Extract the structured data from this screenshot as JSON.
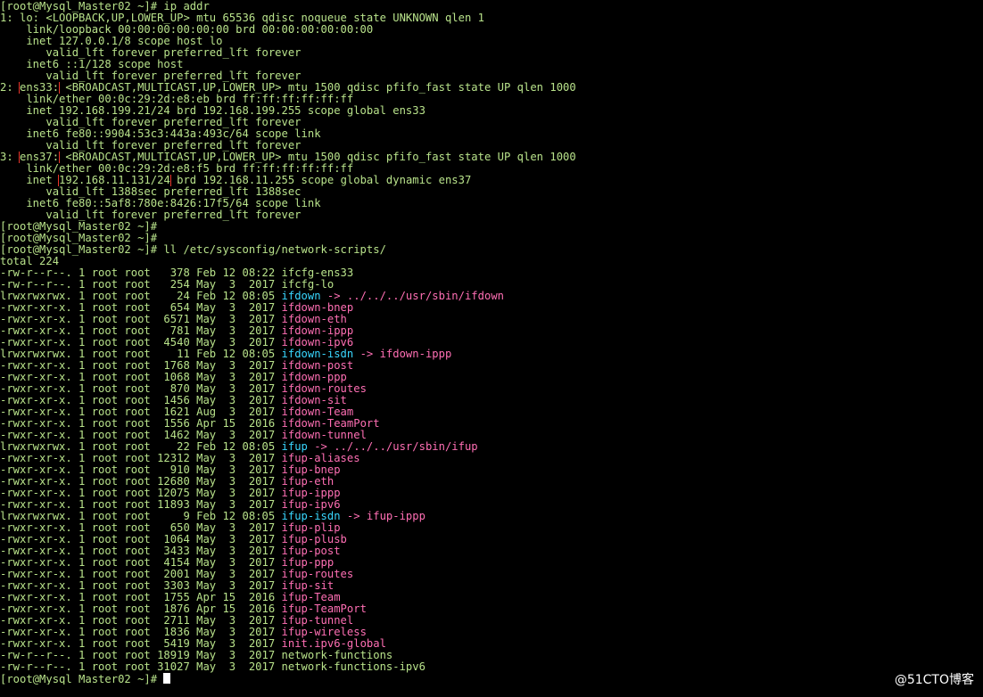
{
  "terminal": {
    "colors": {
      "background": "#000000",
      "text": "#b8e28a",
      "file": "#ff6fb4",
      "symlink": "#39d7ff",
      "highlight_box": "#e8352b",
      "cursor": "#ffffff"
    },
    "lines": [
      [
        {
          "t": "[root@Mysql_Master02 ~]# ip addr",
          "c": "text"
        }
      ],
      [
        {
          "t": "1: lo: <LOOPBACK,UP,LOWER_UP> mtu 65536 qdisc noqueue state UNKNOWN qlen 1",
          "c": "text"
        }
      ],
      [
        {
          "t": "    link/loopback 00:00:00:00:00:00 brd 00:00:00:00:00:00",
          "c": "text"
        }
      ],
      [
        {
          "t": "    inet 127.0.0.1/8 scope host lo",
          "c": "text"
        }
      ],
      [
        {
          "t": "       valid_lft forever preferred_lft forever",
          "c": "text"
        }
      ],
      [
        {
          "t": "    inet6 ::1/128 scope host",
          "c": "text"
        }
      ],
      [
        {
          "t": "       valid_lft forever preferred_lft forever",
          "c": "text"
        }
      ],
      [
        {
          "t": "2: ",
          "c": "text"
        },
        {
          "t": "ens33:",
          "c": "hl"
        },
        {
          "t": " <BROADCAST,MULTICAST,UP,LOWER_UP> mtu 1500 qdisc pfifo_fast state UP qlen 1000",
          "c": "text"
        }
      ],
      [
        {
          "t": "    link/ether 00:0c:29:2d:e8:eb brd ff:ff:ff:ff:ff:ff",
          "c": "text"
        }
      ],
      [
        {
          "t": "    inet 192.168.199.21/24 brd 192.168.199.255 scope global ens33",
          "c": "text"
        }
      ],
      [
        {
          "t": "       valid_lft forever preferred_lft forever",
          "c": "text"
        }
      ],
      [
        {
          "t": "    inet6 fe80::9904:53c3:443a:493c/64 scope link",
          "c": "text"
        }
      ],
      [
        {
          "t": "       valid_lft forever preferred_lft forever",
          "c": "text"
        }
      ],
      [
        {
          "t": "3: ",
          "c": "text"
        },
        {
          "t": "ens37:",
          "c": "hl"
        },
        {
          "t": " <BROADCAST,MULTICAST,UP,LOWER_UP> mtu 1500 qdisc pfifo_fast state UP qlen 1000",
          "c": "text"
        }
      ],
      [
        {
          "t": "    link/ether 00:0c:29:2d:e8:f5 brd ff:ff:ff:ff:ff:ff",
          "c": "text"
        }
      ],
      [
        {
          "t": "    inet ",
          "c": "text"
        },
        {
          "t": "192.168.11.131/24",
          "c": "hl"
        },
        {
          "t": " brd 192.168.11.255 scope global dynamic ens37",
          "c": "text"
        }
      ],
      [
        {
          "t": "       valid_lft 1388sec preferred_lft 1388sec",
          "c": "text"
        }
      ],
      [
        {
          "t": "    inet6 fe80::5af8:780e:8426:17f5/64 scope link",
          "c": "text"
        }
      ],
      [
        {
          "t": "       valid_lft forever preferred_lft forever",
          "c": "text"
        }
      ],
      [
        {
          "t": "[root@Mysql_Master02 ~]#",
          "c": "text"
        }
      ],
      [
        {
          "t": "[root@Mysql_Master02 ~]#",
          "c": "text"
        }
      ],
      [
        {
          "t": "[root@Mysql_Master02 ~]# ll /etc/sysconfig/network-scripts/",
          "c": "text"
        }
      ],
      [
        {
          "t": "total 224",
          "c": "text"
        }
      ],
      [
        {
          "t": "-rw-r--r--. 1 root root   378 Feb 12 08:22 ",
          "c": "text"
        },
        {
          "t": "ifcfg-ens33",
          "c": "text"
        }
      ],
      [
        {
          "t": "-rw-r--r--. 1 root root   254 May  3  2017 ",
          "c": "text"
        },
        {
          "t": "ifcfg-lo",
          "c": "text"
        }
      ],
      [
        {
          "t": "lrwxrwxrwx. 1 root root    24 Feb 12 08:05 ",
          "c": "text"
        },
        {
          "t": "ifdown",
          "c": "link"
        },
        {
          "t": " -> ../../../usr/sbin/ifdown",
          "c": "file"
        }
      ],
      [
        {
          "t": "-rwxr-xr-x. 1 root root   654 May  3  2017 ",
          "c": "text"
        },
        {
          "t": "ifdown-bnep",
          "c": "file"
        }
      ],
      [
        {
          "t": "-rwxr-xr-x. 1 root root  6571 May  3  2017 ",
          "c": "text"
        },
        {
          "t": "ifdown-eth",
          "c": "file"
        }
      ],
      [
        {
          "t": "-rwxr-xr-x. 1 root root   781 May  3  2017 ",
          "c": "text"
        },
        {
          "t": "ifdown-ippp",
          "c": "file"
        }
      ],
      [
        {
          "t": "-rwxr-xr-x. 1 root root  4540 May  3  2017 ",
          "c": "text"
        },
        {
          "t": "ifdown-ipv6",
          "c": "file"
        }
      ],
      [
        {
          "t": "lrwxrwxrwx. 1 root root    11 Feb 12 08:05 ",
          "c": "text"
        },
        {
          "t": "ifdown-isdn",
          "c": "link"
        },
        {
          "t": " -> ifdown-ippp",
          "c": "file"
        }
      ],
      [
        {
          "t": "-rwxr-xr-x. 1 root root  1768 May  3  2017 ",
          "c": "text"
        },
        {
          "t": "ifdown-post",
          "c": "file"
        }
      ],
      [
        {
          "t": "-rwxr-xr-x. 1 root root  1068 May  3  2017 ",
          "c": "text"
        },
        {
          "t": "ifdown-ppp",
          "c": "file"
        }
      ],
      [
        {
          "t": "-rwxr-xr-x. 1 root root   870 May  3  2017 ",
          "c": "text"
        },
        {
          "t": "ifdown-routes",
          "c": "file"
        }
      ],
      [
        {
          "t": "-rwxr-xr-x. 1 root root  1456 May  3  2017 ",
          "c": "text"
        },
        {
          "t": "ifdown-sit",
          "c": "file"
        }
      ],
      [
        {
          "t": "-rwxr-xr-x. 1 root root  1621 Aug  3  2017 ",
          "c": "text"
        },
        {
          "t": "ifdown-Team",
          "c": "file"
        }
      ],
      [
        {
          "t": "-rwxr-xr-x. 1 root root  1556 Apr 15  2016 ",
          "c": "text"
        },
        {
          "t": "ifdown-TeamPort",
          "c": "file"
        }
      ],
      [
        {
          "t": "-rwxr-xr-x. 1 root root  1462 May  3  2017 ",
          "c": "text"
        },
        {
          "t": "ifdown-tunnel",
          "c": "file"
        }
      ],
      [
        {
          "t": "lrwxrwxrwx. 1 root root    22 Feb 12 08:05 ",
          "c": "text"
        },
        {
          "t": "ifup",
          "c": "link"
        },
        {
          "t": " -> ../../../usr/sbin/ifup",
          "c": "file"
        }
      ],
      [
        {
          "t": "-rwxr-xr-x. 1 root root 12312 May  3  2017 ",
          "c": "text"
        },
        {
          "t": "ifup-aliases",
          "c": "file"
        }
      ],
      [
        {
          "t": "-rwxr-xr-x. 1 root root   910 May  3  2017 ",
          "c": "text"
        },
        {
          "t": "ifup-bnep",
          "c": "file"
        }
      ],
      [
        {
          "t": "-rwxr-xr-x. 1 root root 12680 May  3  2017 ",
          "c": "text"
        },
        {
          "t": "ifup-eth",
          "c": "file"
        }
      ],
      [
        {
          "t": "-rwxr-xr-x. 1 root root 12075 May  3  2017 ",
          "c": "text"
        },
        {
          "t": "ifup-ippp",
          "c": "file"
        }
      ],
      [
        {
          "t": "-rwxr-xr-x. 1 root root 11893 May  3  2017 ",
          "c": "text"
        },
        {
          "t": "ifup-ipv6",
          "c": "file"
        }
      ],
      [
        {
          "t": "lrwxrwxrwx. 1 root root     9 Feb 12 08:05 ",
          "c": "text"
        },
        {
          "t": "ifup-isdn",
          "c": "link"
        },
        {
          "t": " -> ifup-ippp",
          "c": "file"
        }
      ],
      [
        {
          "t": "-rwxr-xr-x. 1 root root   650 May  3  2017 ",
          "c": "text"
        },
        {
          "t": "ifup-plip",
          "c": "file"
        }
      ],
      [
        {
          "t": "-rwxr-xr-x. 1 root root  1064 May  3  2017 ",
          "c": "text"
        },
        {
          "t": "ifup-plusb",
          "c": "file"
        }
      ],
      [
        {
          "t": "-rwxr-xr-x. 1 root root  3433 May  3  2017 ",
          "c": "text"
        },
        {
          "t": "ifup-post",
          "c": "file"
        }
      ],
      [
        {
          "t": "-rwxr-xr-x. 1 root root  4154 May  3  2017 ",
          "c": "text"
        },
        {
          "t": "ifup-ppp",
          "c": "file"
        }
      ],
      [
        {
          "t": "-rwxr-xr-x. 1 root root  2001 May  3  2017 ",
          "c": "text"
        },
        {
          "t": "ifup-routes",
          "c": "file"
        }
      ],
      [
        {
          "t": "-rwxr-xr-x. 1 root root  3303 May  3  2017 ",
          "c": "text"
        },
        {
          "t": "ifup-sit",
          "c": "file"
        }
      ],
      [
        {
          "t": "-rwxr-xr-x. 1 root root  1755 Apr 15  2016 ",
          "c": "text"
        },
        {
          "t": "ifup-Team",
          "c": "file"
        }
      ],
      [
        {
          "t": "-rwxr-xr-x. 1 root root  1876 Apr 15  2016 ",
          "c": "text"
        },
        {
          "t": "ifup-TeamPort",
          "c": "file"
        }
      ],
      [
        {
          "t": "-rwxr-xr-x. 1 root root  2711 May  3  2017 ",
          "c": "text"
        },
        {
          "t": "ifup-tunnel",
          "c": "file"
        }
      ],
      [
        {
          "t": "-rwxr-xr-x. 1 root root  1836 May  3  2017 ",
          "c": "text"
        },
        {
          "t": "ifup-wireless",
          "c": "file"
        }
      ],
      [
        {
          "t": "-rwxr-xr-x. 1 root root  5419 May  3  2017 ",
          "c": "text"
        },
        {
          "t": "init.ipv6-global",
          "c": "file"
        }
      ],
      [
        {
          "t": "-rw-r--r--. 1 root root 18919 May  3  2017 ",
          "c": "text"
        },
        {
          "t": "network-functions",
          "c": "text"
        }
      ],
      [
        {
          "t": "-rw-r--r--. 1 root root 31027 May  3  2017 ",
          "c": "text"
        },
        {
          "t": "network-functions-ipv6",
          "c": "text"
        }
      ],
      [
        {
          "t": "[root@Mysql_Master02 ~]# ",
          "c": "text"
        },
        {
          "t": "",
          "c": "cursor"
        }
      ]
    ]
  },
  "watermark": "@51CTO博客"
}
